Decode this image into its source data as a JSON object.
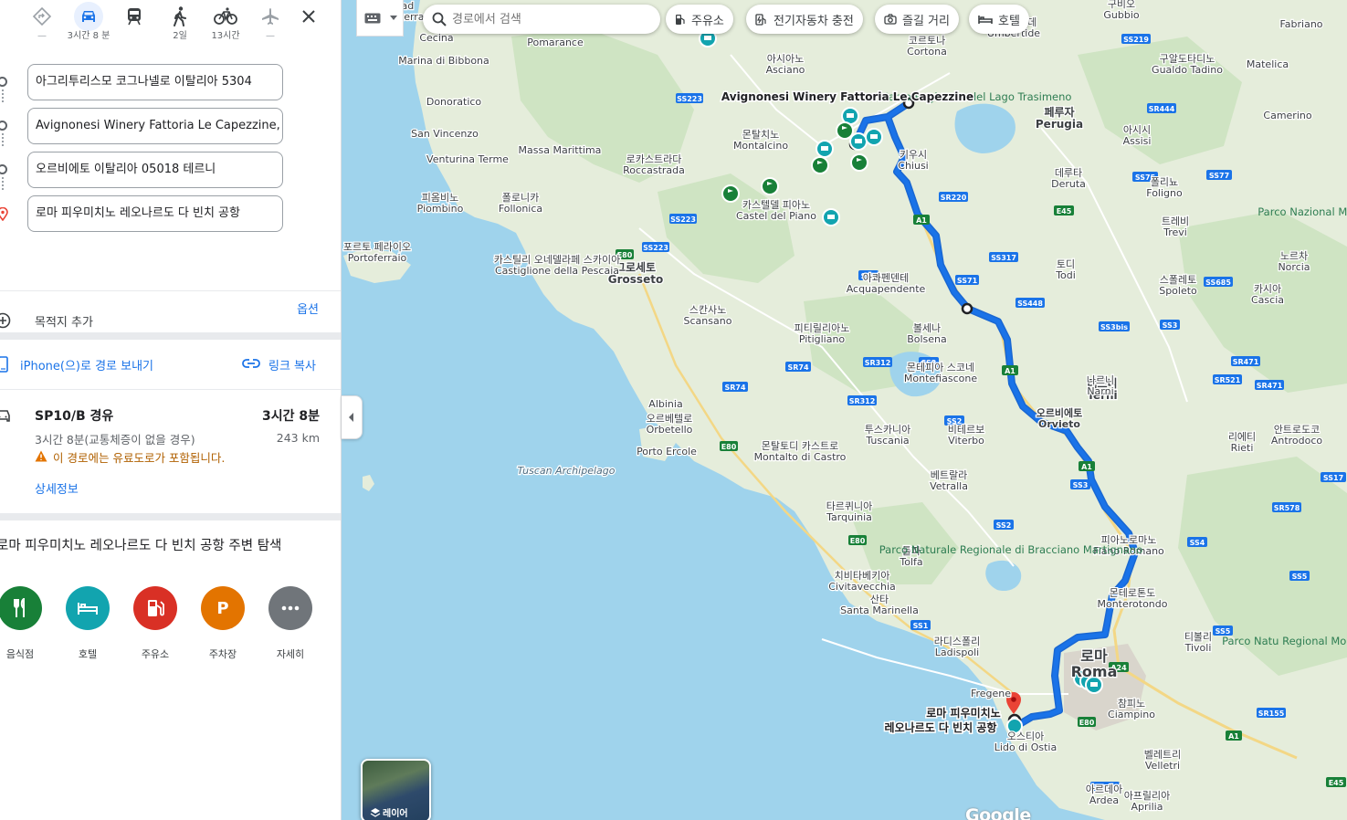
{
  "travel_modes": [
    {
      "name": "directions",
      "label": "—"
    },
    {
      "name": "car",
      "label": "3시간 8 분",
      "active": true
    },
    {
      "name": "transit",
      "label": ""
    },
    {
      "name": "walk",
      "label": "2일"
    },
    {
      "name": "bicycle",
      "label": "13시간"
    },
    {
      "name": "flight",
      "label": "—"
    }
  ],
  "stops": [
    "아그리투리스모 코그나넬로 이탈리아 5304",
    "Avignonesi Winery Fattoria Le Capezzine, V",
    "오르비에토 이탈리아 05018 테르니",
    "로마 피우미치노 레오나르도 다 빈치 공항"
  ],
  "add_destination": "목적지 추가",
  "options_label": "옵션",
  "send_to_phone": "iPhone(으)로 경로 보내기",
  "copy_link": "링크 복사",
  "route": {
    "via": "SP10/B 경유",
    "duration": "3시간 8분",
    "subtitle": "3시간 8분(교통체증이 없을 경우)",
    "distance": "243 km",
    "warning": "이 경로에는 유료도로가 포함됩니다.",
    "details": "상세정보"
  },
  "explore_title": "로마 피우미치노 레오나르도 다 빈치 공항 주변 탐색",
  "categories": [
    {
      "label": "음식점",
      "color": "#188038",
      "icon": "restaurant-icon"
    },
    {
      "label": "호텔",
      "color": "#12a4af",
      "icon": "hotel-icon"
    },
    {
      "label": "주유소",
      "color": "#d93025",
      "icon": "gas-icon"
    },
    {
      "label": "주차장",
      "color": "#e37400",
      "icon": "parking-icon"
    },
    {
      "label": "자세히",
      "color": "#70757a",
      "icon": "more-icon"
    }
  ],
  "search_placeholder": "경로에서 검색",
  "chips": [
    "주유소",
    "전기자동차 충전",
    "즐길 거리",
    "호텔"
  ],
  "layers_label": "레이어",
  "google_logo": "Google",
  "map_labels": {
    "avignonesi": "Avignonesi Winery Fattoria Le Capezzine",
    "airport_ko": "로마 피우미치노",
    "airport_ko2": "레오나르도 다 빈치 공항",
    "cities": [
      [
        "Volterra",
        "Vad"
      ],
      [
        "Cecina",
        ""
      ],
      [
        "Pomarance",
        ""
      ],
      [
        "Marina di Bibbona",
        ""
      ],
      [
        "Donoratico",
        ""
      ],
      [
        "San Vincenzo",
        ""
      ],
      [
        "Venturina Terme",
        ""
      ],
      [
        "Massa Marittima",
        ""
      ],
      [
        "Roccastrada",
        "로카스트라다"
      ],
      [
        "Montalcino",
        "몬탈치노"
      ],
      [
        "Asciano",
        "아시아노"
      ],
      [
        "Cortona",
        "코르토나"
      ],
      [
        "Umbertide",
        "움베르티데"
      ],
      [
        "Gubbio",
        "구비오"
      ],
      [
        "Fabriano",
        ""
      ],
      [
        "Gualdo Tadino",
        "구알도타디노"
      ],
      [
        "Matelica",
        ""
      ],
      [
        "Perugia",
        "페루자"
      ],
      [
        "Assisi",
        "아시시"
      ],
      [
        "Camerino",
        ""
      ],
      [
        "Deruta",
        "데루타"
      ],
      [
        "Foligno",
        "폴리뇨"
      ],
      [
        "Trevi",
        "트레비"
      ],
      [
        "Chiusi",
        "키우시"
      ],
      [
        "Castel del Piano",
        "카스텔델 피아노"
      ],
      [
        "Piombino",
        "피옴비노"
      ],
      [
        "Follonica",
        "폴로니카"
      ],
      [
        "Portoferraio",
        "포르토 페라이오"
      ],
      [
        "Grosseto",
        "그로세토"
      ],
      [
        "Castiglione della Pescaia",
        "카스틸리 오네델라페 스카이아"
      ],
      [
        "Acquapendente",
        "아콰펜덴테"
      ],
      [
        "Todi",
        "토디"
      ],
      [
        "Spoleto",
        "스폴레토"
      ],
      [
        "Norcia",
        "노르차"
      ],
      [
        "Cascia",
        "카시아"
      ],
      [
        "Scansano",
        "스칸사노"
      ],
      [
        "Pitigliano",
        "피티릴리아노"
      ],
      [
        "Bolsena",
        "볼세나"
      ],
      [
        "Montefiascone",
        "몬테피아 스코네"
      ],
      [
        "Orvieto",
        "오르비에토"
      ],
      [
        "Terni",
        "테르니"
      ],
      [
        "Narni",
        "나르니"
      ],
      [
        "Albinia",
        ""
      ],
      [
        "Orbetello",
        "오르베텔로"
      ],
      [
        "Porto Ercole",
        ""
      ],
      [
        "Tuscania",
        "투스카니아"
      ],
      [
        "Viterbo",
        "비테르보"
      ],
      [
        "Rieti",
        "리에티"
      ],
      [
        "Antrodoco",
        "안트로도코"
      ],
      [
        "Montalto di Castro",
        "몬탈토디 카스트로"
      ],
      [
        "Vetralla",
        "베트랄라"
      ],
      [
        "Tarquinia",
        "타르퀴니아"
      ],
      [
        "Tolfa",
        "톨파"
      ],
      [
        "Civitavecchia",
        "치비타베키아"
      ],
      [
        "Santa Marinella",
        "산타"
      ],
      [
        "Ladispoli",
        "라디스폴리"
      ],
      [
        "Fiano Romano",
        "피아노로마노"
      ],
      [
        "Monterotondo",
        "몬테로톤도"
      ],
      [
        "Tivoli",
        "티볼리"
      ],
      [
        "Roma",
        "로마"
      ],
      [
        "Ciampino",
        "참피노"
      ],
      [
        "Lido di Ostia",
        "오스티아"
      ],
      [
        "Velletri",
        "벨레트리"
      ],
      [
        "Ardea",
        "아르데아"
      ],
      [
        "Aprilia",
        "아프릴리아"
      ],
      [
        "Fregene",
        ""
      ],
      [
        "Tuscan Archipelago",
        ""
      ]
    ],
    "parks": [
      "Parco Regionale del Lago Trasimeno",
      "Parco Naturale Regionale di Bracciano Martignano",
      "Parco Nazional Monti Sib",
      "Parco Natu Regional Monti Simbruir"
    ]
  }
}
